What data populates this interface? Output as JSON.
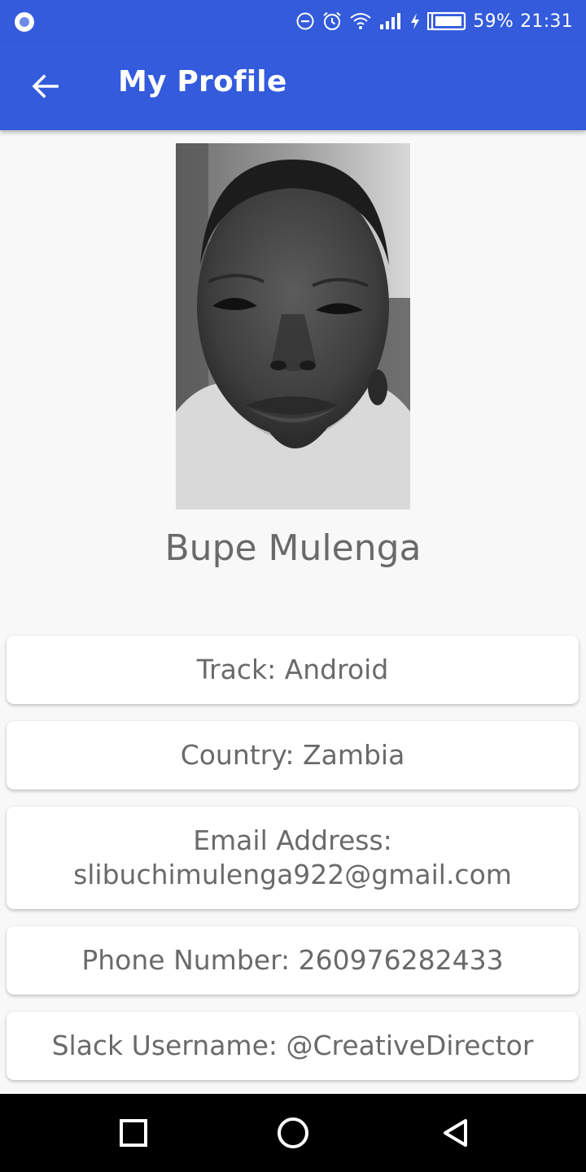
{
  "status_bar": {
    "battery": "59%",
    "time": "21:31",
    "icons": [
      "notification-dot-icon",
      "do-not-disturb-icon",
      "alarm-icon",
      "wifi-icon",
      "signal-icon",
      "charging-icon",
      "battery-icon"
    ]
  },
  "app_bar": {
    "title": "My Profile",
    "back_icon": "arrow-back-icon",
    "background": "#335bdb"
  },
  "profile": {
    "photo": "profile-photo",
    "name": "Bupe Mulenga"
  },
  "details": {
    "track": "Track: Android",
    "country": "Country: Zambia",
    "email_label": "Email Address:",
    "email_value": "slibuchimulenga922@gmail.com",
    "phone": "Phone Number: 260976282433",
    "slack": "Slack Username: @CreativeDirector"
  },
  "nav_bar": {
    "icons": [
      "recents-square-icon",
      "home-circle-icon",
      "back-triangle-icon"
    ]
  }
}
